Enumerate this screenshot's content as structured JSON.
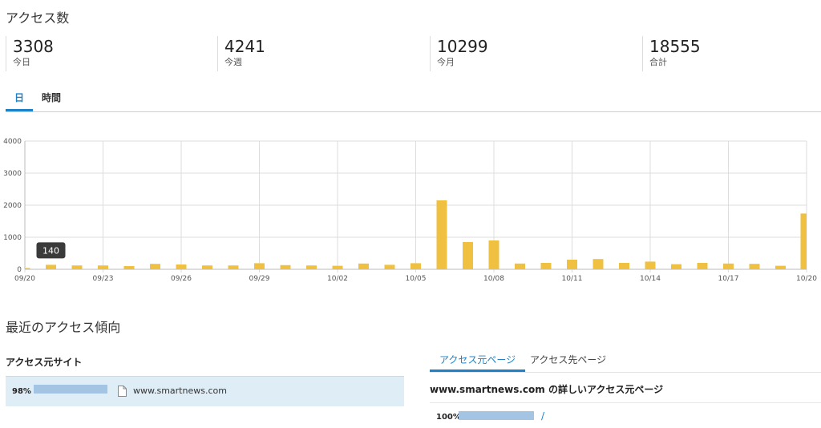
{
  "page_title": "アクセス数",
  "stats": [
    {
      "value": "3308",
      "label": "今日"
    },
    {
      "value": "4241",
      "label": "今週"
    },
    {
      "value": "10299",
      "label": "今月"
    },
    {
      "value": "18555",
      "label": "合計"
    }
  ],
  "chart_tabs": [
    {
      "label": "日",
      "active": true
    },
    {
      "label": "時間",
      "active": false
    }
  ],
  "chart_data": {
    "type": "bar",
    "ylim": [
      0,
      4000
    ],
    "yticks": [
      "0",
      "1000",
      "2000",
      "3000",
      "4000"
    ],
    "ytick_values": [
      0,
      1000,
      2000,
      3000,
      4000
    ],
    "xtick_labels": [
      "09/20",
      "09/23",
      "09/26",
      "09/29",
      "10/02",
      "10/05",
      "10/08",
      "10/11",
      "10/14",
      "10/17",
      "10/20"
    ],
    "categories": [
      "09/20",
      "09/21",
      "09/22",
      "09/23",
      "09/24",
      "09/25",
      "09/26",
      "09/27",
      "09/28",
      "09/29",
      "09/30",
      "10/01",
      "10/02",
      "10/03",
      "10/04",
      "10/05",
      "10/06",
      "10/07",
      "10/08",
      "10/09",
      "10/10",
      "10/11",
      "10/12",
      "10/13",
      "10/14",
      "10/15",
      "10/16",
      "10/17",
      "10/18",
      "10/19",
      "10/20"
    ],
    "values": [
      40,
      140,
      120,
      120,
      100,
      170,
      150,
      120,
      120,
      190,
      130,
      120,
      110,
      180,
      140,
      190,
      2150,
      850,
      900,
      180,
      200,
      300,
      320,
      200,
      240,
      160,
      200,
      180,
      170,
      110,
      1740
    ],
    "bar_color": "#f0c040",
    "grid": true,
    "tooltip": {
      "category": "09/21",
      "value": "140"
    }
  },
  "trend": {
    "title": "最近のアクセス傾向",
    "referrer_sites": {
      "title": "アクセス元サイト",
      "items": [
        {
          "percent": "98%",
          "fraction": 0.98,
          "site": "www.smartnews.com"
        }
      ]
    },
    "page_tabs": [
      {
        "label": "アクセス元ページ",
        "active": true
      },
      {
        "label": "アクセス先ページ",
        "active": false
      }
    ],
    "detail_title": "www.smartnews.com の詳しいアクセス元ページ",
    "detail_items": [
      {
        "percent": "100%",
        "fraction": 1.0,
        "path": "/"
      }
    ]
  },
  "colors": {
    "accent": "#1e82c8",
    "bar": "#f0c040",
    "meter": "#a4c4e4",
    "row_highlight": "#deedf6"
  }
}
